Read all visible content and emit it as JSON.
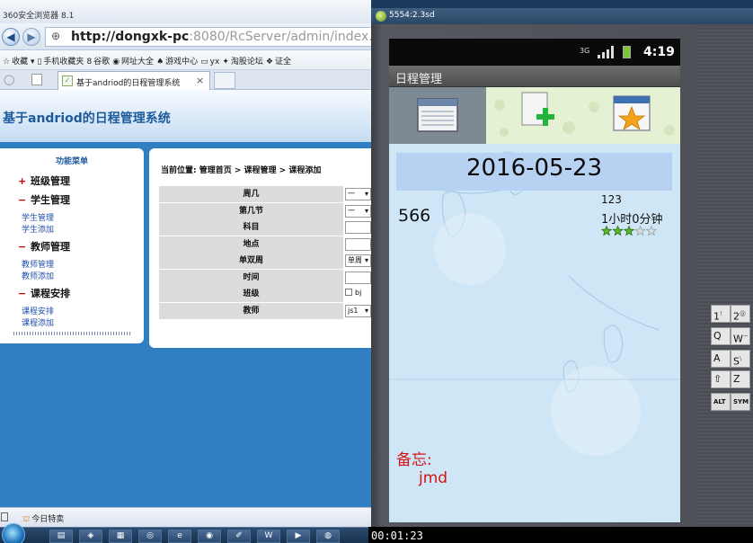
{
  "browser": {
    "title": "360安全浏览器 8.1",
    "url_host": "http://dongxk-pc",
    "url_rest": ":8080/RcServer/admin/index.jsp",
    "bookmarks": [
      {
        "icon": "star-icon",
        "label": "收藏 ▾"
      },
      {
        "icon": "phone-icon",
        "label": "手机收藏夹"
      },
      {
        "icon": "google-icon",
        "label": "谷歌"
      },
      {
        "icon": "globe-icon",
        "label": "网址大全"
      },
      {
        "icon": "game-icon",
        "label": "游戏中心"
      },
      {
        "icon": "page-icon",
        "label": "yx"
      },
      {
        "icon": "shop-icon",
        "label": "淘股论坛"
      },
      {
        "icon": "stock-icon",
        "label": "证全"
      }
    ],
    "tab_label": "基于andriod的日程管理系统",
    "tab_close": "×",
    "status_text": "今日特卖"
  },
  "page": {
    "title": "基于andriod的日程管理系统",
    "menu_title": "功能菜单",
    "menu": [
      {
        "mark": "+",
        "label": "班级管理",
        "links": []
      },
      {
        "mark": "−",
        "label": "学生管理",
        "links": [
          "学生管理",
          "学生添加"
        ]
      },
      {
        "mark": "−",
        "label": "教师管理",
        "links": [
          "教师管理",
          "教师添加"
        ]
      },
      {
        "mark": "−",
        "label": "课程安排",
        "links": [
          "课程安排",
          "课程添加"
        ]
      }
    ],
    "breadcrumb": "当前位置: 管理首页 > 课程管理 > 课程添加",
    "form": [
      {
        "label": "周几",
        "type": "select",
        "value": "一"
      },
      {
        "label": "第几节",
        "type": "select",
        "value": "一"
      },
      {
        "label": "科目",
        "type": "input",
        "value": ""
      },
      {
        "label": "地点",
        "type": "input",
        "value": ""
      },
      {
        "label": "单双周",
        "type": "select",
        "value": "单周"
      },
      {
        "label": "时间",
        "type": "input",
        "value": ""
      },
      {
        "label": "班级",
        "type": "checkbox",
        "value": "bj"
      },
      {
        "label": "教师",
        "type": "select",
        "value": "js1"
      }
    ]
  },
  "emulator": {
    "title": "5554:2.3sd",
    "keys": [
      {
        "label": "1",
        "sup": "!"
      },
      {
        "label": "2",
        "sup": "@"
      },
      {
        "label": "Q",
        "sup": ""
      },
      {
        "label": "W",
        "sup": "~"
      },
      {
        "label": "A",
        "sup": ""
      },
      {
        "label": "S",
        "sup": "\\"
      },
      {
        "label": "⇧",
        "sup": ""
      },
      {
        "label": "Z",
        "sup": ""
      },
      {
        "label": "ALT",
        "sup": ""
      },
      {
        "label": "SYM",
        "sup": ""
      }
    ]
  },
  "phone": {
    "network": "3G",
    "time": "4:19",
    "app_title": "日程管理",
    "tabs": [
      {
        "icon": "calendar-list-icon"
      },
      {
        "icon": "add-schedule-icon"
      },
      {
        "icon": "favorite-calendar-icon"
      }
    ],
    "date": "2016-05-23",
    "event_title": "566",
    "event_time": "123",
    "event_duration": "1小时0分钟",
    "rating": 3,
    "rating_max": 5,
    "memo_label": "备忘:",
    "memo_text": "jmd"
  },
  "taskbar": {
    "clock": "00:01:23",
    "apps": [
      "explorer",
      "media",
      "folder",
      "browser-360",
      "ie",
      "chrome",
      "tool",
      "word",
      "ppt",
      "android"
    ]
  },
  "colors": {
    "page_blue": "#2f7fc2",
    "memo_red": "#d41515",
    "date_bar": "#b7d1f2",
    "tab_green": "#e4f1d2"
  }
}
